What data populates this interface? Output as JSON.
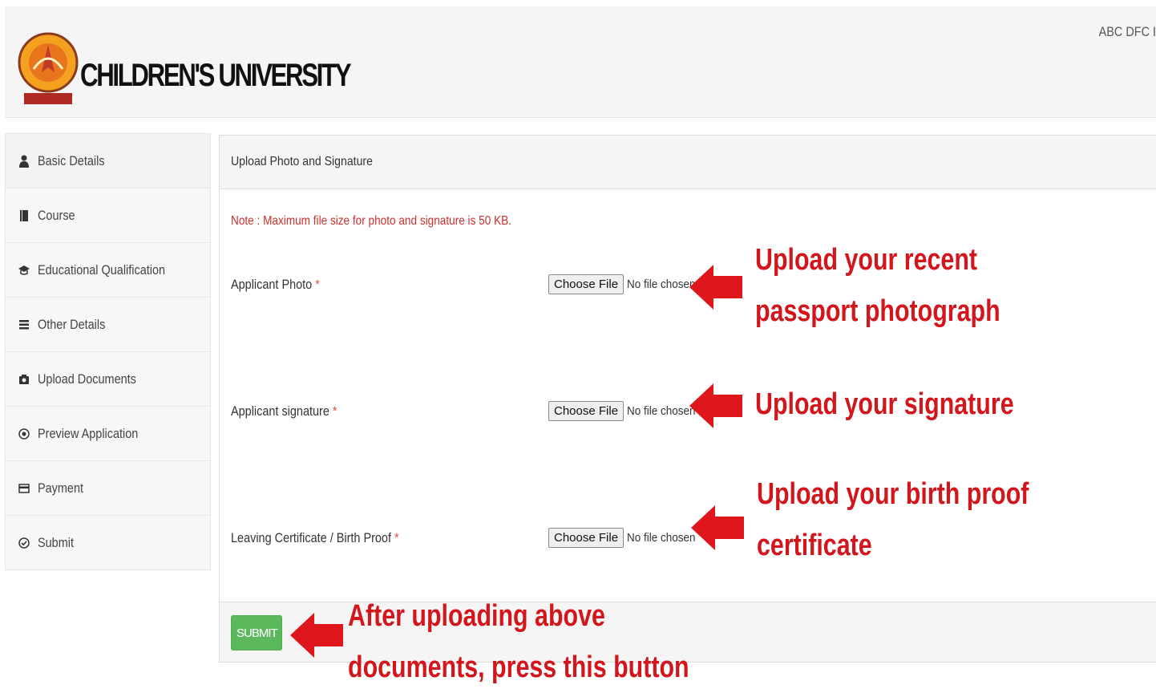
{
  "header": {
    "brand": "CHILDREN'S UNIVERSITY",
    "user": "ABC DFC I"
  },
  "sidebar": {
    "items": [
      {
        "label": "Basic Details",
        "icon": "user-icon"
      },
      {
        "label": "Course",
        "icon": "book-icon"
      },
      {
        "label": "Educational Qualification",
        "icon": "graduation-icon"
      },
      {
        "label": "Other Details",
        "icon": "list-icon"
      },
      {
        "label": "Upload Documents",
        "icon": "upload-icon"
      },
      {
        "label": "Preview Application",
        "icon": "eye-icon"
      },
      {
        "label": "Payment",
        "icon": "credit-card-icon"
      },
      {
        "label": "Submit",
        "icon": "check-circle-icon"
      }
    ]
  },
  "panel": {
    "title": "Upload Photo and Signature",
    "note": "Note : Maximum file size for photo and signature is 50 KB.",
    "fields": [
      {
        "label": "Applicant Photo",
        "button": "Choose File",
        "status": "No file chosen"
      },
      {
        "label": "Applicant signature",
        "button": "Choose File",
        "status": "No file chosen"
      },
      {
        "label": "Leaving Certificate / Birth Proof",
        "button": "Choose File",
        "status": "No file chosen"
      }
    ],
    "required_mark": "*",
    "submit": "SUBMIT"
  },
  "annotations": {
    "photo_line1": "Upload your recent",
    "photo_line2": "passport photograph",
    "signature": "Upload your signature",
    "birth_line1": "Upload your birth proof",
    "birth_line2": "certificate",
    "submit_line1": "After uploading above",
    "submit_line2": "documents, press this button",
    "color": "#d3151c"
  }
}
